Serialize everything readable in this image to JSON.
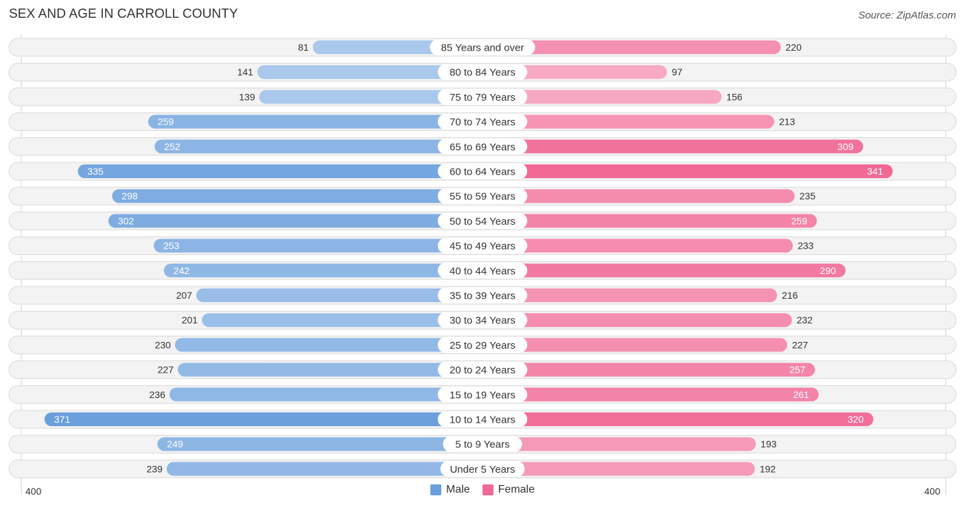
{
  "header": {
    "title": "SEX AND AGE IN CARROLL COUNTY",
    "source": "Source: ZipAtlas.com"
  },
  "colors": {
    "male": "#6a9fdc",
    "male_light": "#a9c8ec",
    "female": "#f06894",
    "female_light": "#f7a9c3"
  },
  "chart_data": {
    "type": "bar",
    "orientation": "horizontal-diverging",
    "title": "SEX AND AGE IN CARROLL COUNTY",
    "categories": [
      "85 Years and over",
      "80 to 84 Years",
      "75 to 79 Years",
      "70 to 74 Years",
      "65 to 69 Years",
      "60 to 64 Years",
      "55 to 59 Years",
      "50 to 54 Years",
      "45 to 49 Years",
      "40 to 44 Years",
      "35 to 39 Years",
      "30 to 34 Years",
      "25 to 29 Years",
      "20 to 24 Years",
      "15 to 19 Years",
      "10 to 14 Years",
      "5 to 9 Years",
      "Under 5 Years"
    ],
    "series": [
      {
        "name": "Male",
        "values": [
          81,
          141,
          139,
          259,
          252,
          335,
          298,
          302,
          253,
          242,
          207,
          201,
          230,
          227,
          236,
          371,
          249,
          239
        ]
      },
      {
        "name": "Female",
        "values": [
          220,
          97,
          156,
          213,
          309,
          341,
          235,
          259,
          233,
          290,
          216,
          232,
          227,
          257,
          261,
          320,
          193,
          192
        ]
      }
    ],
    "xlim": [
      400,
      400
    ],
    "axis_labels": {
      "left": "400",
      "right": "400"
    },
    "legend": [
      "Male",
      "Female"
    ],
    "legend_position": "bottom-center"
  }
}
